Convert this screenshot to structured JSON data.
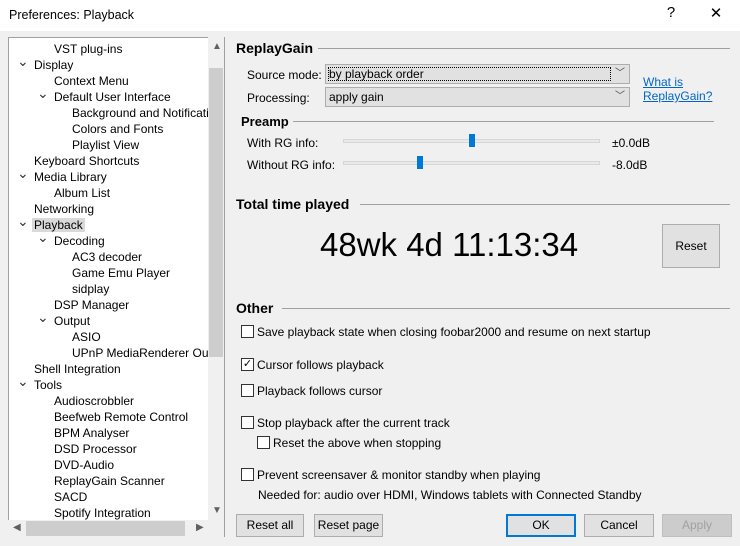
{
  "window": {
    "title": "Preferences: Playback",
    "help": "?",
    "close": "✕"
  },
  "tree": [
    {
      "label": "VST plug-ins",
      "level": 1,
      "expanded": null
    },
    {
      "label": "Display",
      "level": 0,
      "expanded": true
    },
    {
      "label": "Context Menu",
      "level": 1,
      "expanded": null
    },
    {
      "label": "Default User Interface",
      "level": 1,
      "expanded": true
    },
    {
      "label": "Background and Notifications",
      "level": 2,
      "expanded": null
    },
    {
      "label": "Colors and Fonts",
      "level": 2,
      "expanded": null
    },
    {
      "label": "Playlist View",
      "level": 2,
      "expanded": null
    },
    {
      "label": "Keyboard Shortcuts",
      "level": 0,
      "expanded": null
    },
    {
      "label": "Media Library",
      "level": 0,
      "expanded": true
    },
    {
      "label": "Album List",
      "level": 1,
      "expanded": null
    },
    {
      "label": "Networking",
      "level": 0,
      "expanded": null
    },
    {
      "label": "Playback",
      "level": 0,
      "expanded": true,
      "selected": true
    },
    {
      "label": "Decoding",
      "level": 1,
      "expanded": true
    },
    {
      "label": "AC3 decoder",
      "level": 2,
      "expanded": null
    },
    {
      "label": "Game Emu Player",
      "level": 2,
      "expanded": null
    },
    {
      "label": "sidplay",
      "level": 2,
      "expanded": null
    },
    {
      "label": "DSP Manager",
      "level": 1,
      "expanded": null
    },
    {
      "label": "Output",
      "level": 1,
      "expanded": true
    },
    {
      "label": "ASIO",
      "level": 2,
      "expanded": null
    },
    {
      "label": "UPnP MediaRenderer Output",
      "level": 2,
      "expanded": null
    },
    {
      "label": "Shell Integration",
      "level": 0,
      "expanded": null
    },
    {
      "label": "Tools",
      "level": 0,
      "expanded": true
    },
    {
      "label": "Audioscrobbler",
      "level": 1,
      "expanded": null
    },
    {
      "label": "Beefweb Remote Control",
      "level": 1,
      "expanded": null
    },
    {
      "label": "BPM Analyser",
      "level": 1,
      "expanded": null
    },
    {
      "label": "DSD Processor",
      "level": 1,
      "expanded": null
    },
    {
      "label": "DVD-Audio",
      "level": 1,
      "expanded": null
    },
    {
      "label": "ReplayGain Scanner",
      "level": 1,
      "expanded": null
    },
    {
      "label": "SACD",
      "level": 1,
      "expanded": null
    },
    {
      "label": "Spotify Integration",
      "level": 1,
      "expanded": null
    }
  ],
  "replaygain": {
    "title": "ReplayGain",
    "source_label": "Source mode:",
    "source_value": "by playback order",
    "processing_label": "Processing:",
    "processing_value": "apply gain",
    "link": "What is ReplayGain?",
    "link_line1": "What is",
    "link_line2": "ReplayGain?"
  },
  "preamp": {
    "title": "Preamp",
    "with_label": "With RG info:",
    "with_value": "±0.0dB",
    "with_fraction": 0.5,
    "without_label": "Without RG info:",
    "without_value": "-8.0dB",
    "without_fraction": 0.3
  },
  "total": {
    "title": "Total time played",
    "value": "48wk 4d 11:13:34",
    "reset": "Reset"
  },
  "other": {
    "title": "Other",
    "options": [
      {
        "label": "Save playback state when closing foobar2000 and resume on next startup",
        "checked": false
      },
      {
        "label": "Cursor follows playback",
        "checked": true
      },
      {
        "label": "Playback follows cursor",
        "checked": false
      },
      {
        "label": "Stop playback after the current track",
        "checked": false
      },
      {
        "label": "Reset the above when stopping",
        "checked": false
      },
      {
        "label": "Prevent screensaver & monitor standby when playing",
        "checked": false
      }
    ],
    "note": "Needed for: audio over HDMI, Windows tablets with Connected Standby"
  },
  "buttons": {
    "reset_all": "Reset all",
    "reset_page": "Reset page",
    "ok": "OK",
    "cancel": "Cancel",
    "apply": "Apply"
  }
}
